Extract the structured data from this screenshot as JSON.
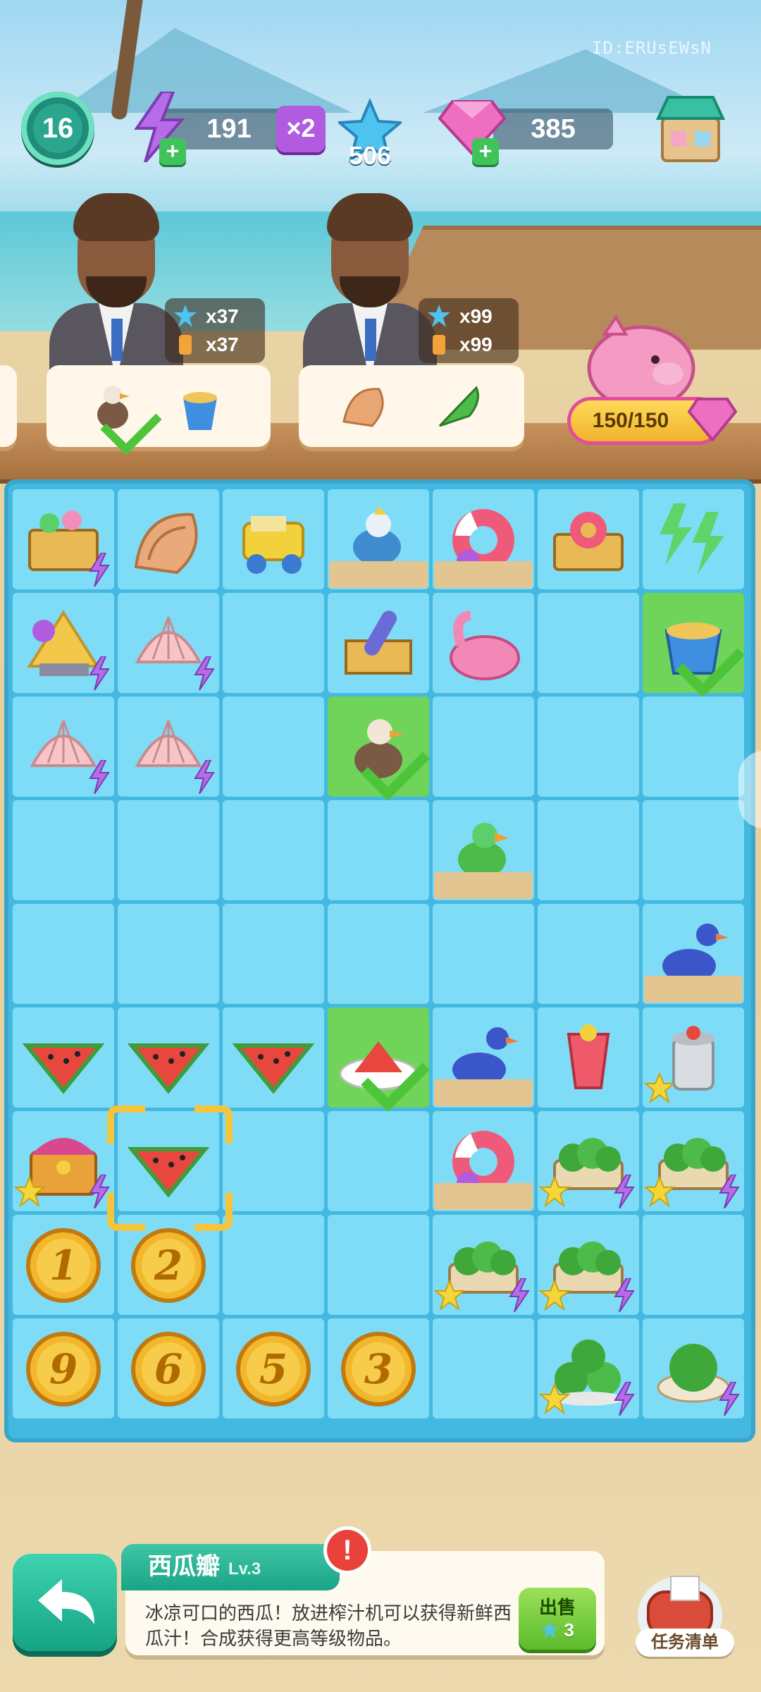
{
  "top_bar": {
    "level": "16",
    "energy": "191",
    "energy_multiplier": "×2",
    "stars": "506",
    "gems": "385",
    "player_id": "ID:ERUsEWsN"
  },
  "orders": [
    {
      "reward_stars": "x37",
      "reward_item": "x37",
      "items": [
        "seagull",
        "sand-bucket"
      ],
      "completed": [
        true,
        false
      ]
    },
    {
      "reward_stars": "x99",
      "reward_item": "x99",
      "items": [
        "conch-shell",
        "spiral-shell"
      ],
      "completed": [
        false,
        false
      ]
    }
  ],
  "piggy_bank": {
    "progress": "150/150",
    "value": 1.0
  },
  "board": {
    "columns": 7,
    "rows": 9,
    "cells": [
      [
        {
          "item": "picnic-basket",
          "bolt": true
        },
        {
          "item": "conch-shell"
        },
        {
          "item": "sand-truck"
        },
        {
          "item": "cockatoo",
          "sand": true
        },
        {
          "item": "swim-ring",
          "sand": true
        },
        {
          "item": "ring-crate"
        },
        {
          "item": "energy-pile"
        }
      ],
      [
        {
          "item": "giant-seashell",
          "bolt": true
        },
        {
          "item": "clam-shell",
          "bolt": true
        },
        {},
        {
          "item": "surf-crate"
        },
        {
          "item": "flamingo-float"
        },
        {},
        {
          "item": "sand-bucket",
          "done": true
        }
      ],
      [
        {
          "item": "clam-shell",
          "bolt": true
        },
        {
          "item": "clam-shell",
          "bolt": true
        },
        {},
        {
          "item": "seagull",
          "done": true
        },
        {},
        {},
        {}
      ],
      [
        {},
        {},
        {},
        {},
        {
          "item": "parrot",
          "sand": true
        },
        {},
        {}
      ],
      [
        {},
        {},
        {},
        {},
        {},
        {},
        {
          "item": "blue-bird",
          "sand": true
        }
      ],
      [
        {
          "item": "watermelon-slice"
        },
        {
          "item": "watermelon-slice"
        },
        {
          "item": "watermelon-slice"
        },
        {
          "item": "watermelon-plate",
          "done": true
        },
        {
          "item": "blue-bird",
          "sand": true
        },
        {
          "item": "watermelon-juice"
        },
        {
          "item": "juicer",
          "star": true
        }
      ],
      [
        {
          "item": "treasure-chest",
          "star": true,
          "bolt": true
        },
        {
          "item": "watermelon-slice",
          "selected": true
        },
        {},
        {},
        {
          "item": "swim-ring",
          "sand": true
        },
        {
          "item": "watermelon-cart",
          "star": true,
          "bolt": true
        },
        {
          "item": "watermelon-cart",
          "star": true,
          "bolt": true
        }
      ],
      [
        {
          "item": "coin",
          "label": "1"
        },
        {
          "item": "coin",
          "label": "2"
        },
        {},
        {},
        {
          "item": "watermelon-cart",
          "star": true,
          "bolt": true
        },
        {
          "item": "watermelon-cart",
          "star": true,
          "bolt": true
        },
        {}
      ],
      [
        {
          "item": "coin",
          "label": "9"
        },
        {
          "item": "coin",
          "label": "6"
        },
        {
          "item": "coin",
          "label": "5"
        },
        {
          "item": "coin",
          "label": "3"
        },
        {},
        {
          "item": "watermelon-pile",
          "star": true,
          "bolt": true
        },
        {
          "item": "watermelon-bowl",
          "bolt": true
        }
      ]
    ]
  },
  "info_panel": {
    "item_name": "西瓜瓣",
    "item_level": "Lv.3",
    "description": "冰凉可口的西瓜！放进榨汁机可以获得新鲜西瓜汁！合成获得更高等级物品。",
    "alert": "!",
    "sell_label": "出售",
    "sell_price": "3"
  },
  "task_list_label": "任务清单",
  "colors": {
    "board": "#43b9e1",
    "cell": "#7fdcf7",
    "cell_done": "#6fd459",
    "accent_green": "#1aa487",
    "gem_pink": "#e34d9a"
  }
}
